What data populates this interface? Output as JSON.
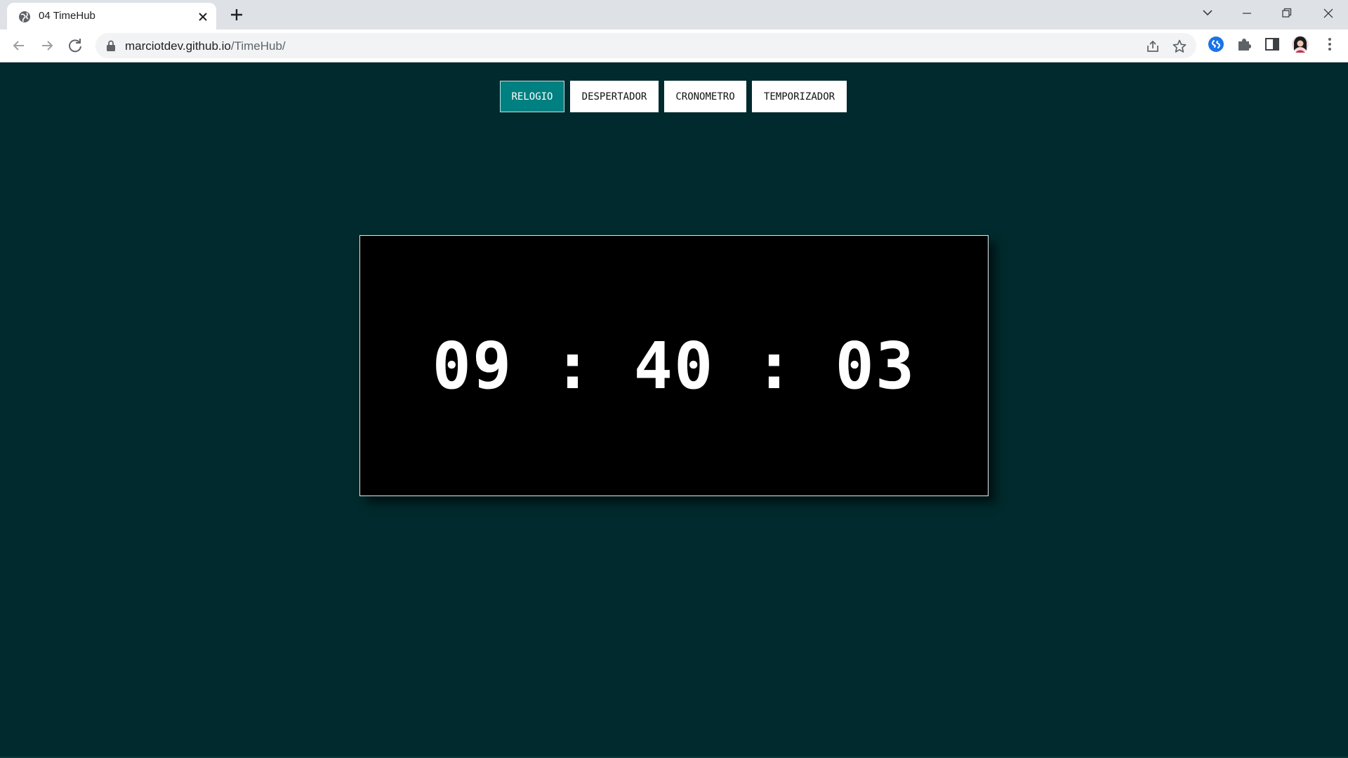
{
  "browser": {
    "tab_title": "04 TimeHub",
    "url_host": "marciotdev.github.io",
    "url_path": "/TimeHub/"
  },
  "app": {
    "modes": [
      {
        "label": "RELOGIO",
        "active": true
      },
      {
        "label": "DESPERTADOR",
        "active": false
      },
      {
        "label": "CRONOMETRO",
        "active": false
      },
      {
        "label": "TEMPORIZADOR",
        "active": false
      }
    ],
    "clock": {
      "hours": "09",
      "minutes": "40",
      "seconds": "03",
      "separator": ":",
      "display": "09 : 40 : 03"
    },
    "colors": {
      "page_bg": "#002a2d",
      "active_tab": "#008080",
      "clock_bg": "#000000",
      "clock_text": "#ffffff"
    }
  }
}
